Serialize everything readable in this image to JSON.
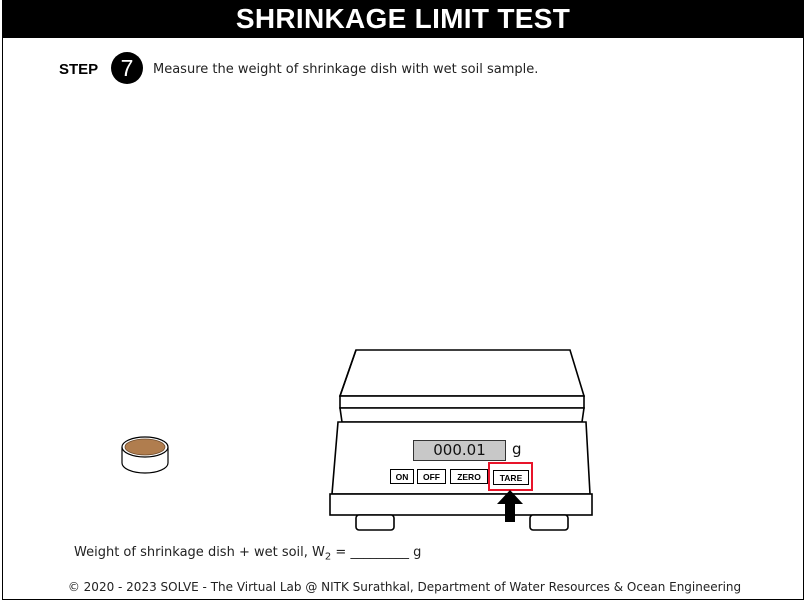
{
  "header": {
    "title": "SHRINKAGE LIMIT TEST"
  },
  "step": {
    "label": "STEP",
    "number": "7",
    "instruction": "Measure the weight of shrinkage dish with wet soil sample."
  },
  "scale": {
    "display_value": "000.01",
    "unit": "g",
    "buttons": {
      "on": "ON",
      "off": "OFF",
      "zero": "ZERO",
      "tare": "TARE"
    },
    "highlighted_button": "TARE",
    "highlight_color": "#e8142a",
    "display_color": "#c8c8c8"
  },
  "sample": {
    "soil_color": "#b07d4e"
  },
  "result": {
    "prefix": "Weight of shrinkage dish + wet soil, W",
    "subscript": "2",
    "suffix": " = _________ g"
  },
  "footer": {
    "text": "© 2020 - 2023 SOLVE - The Virtual Lab @ NITK Surathkal, Department of Water Resources & Ocean Engineering"
  }
}
